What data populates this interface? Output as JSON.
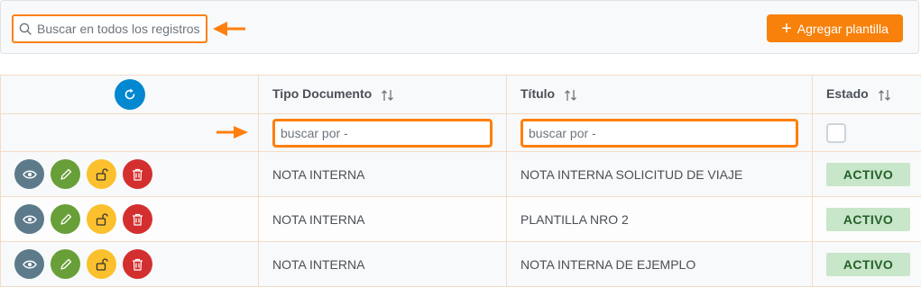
{
  "toolbar": {
    "search_placeholder": "Buscar en todos los registros",
    "add_button_label": "Agregar plantilla"
  },
  "colors": {
    "accent": "#f7810b",
    "highlight": "#ff7f0e",
    "refresh": "#0288d1",
    "view": "#5c7a8a",
    "edit": "#689f38",
    "lock": "#fbc02d",
    "delete": "#d32f2f",
    "status_bg": "#c8e6c9",
    "status_text": "#256029"
  },
  "table": {
    "columns": [
      "",
      "Tipo Documento",
      "Título",
      "Estado"
    ],
    "filter_placeholder": "buscar por -",
    "rows": [
      {
        "tipo": "NOTA INTERNA",
        "titulo": "NOTA INTERNA SOLICITUD DE VIAJE",
        "estado": "ACTIVO"
      },
      {
        "tipo": "NOTA INTERNA",
        "titulo": "PLANTILLA NRO 2",
        "estado": "ACTIVO"
      },
      {
        "tipo": "NOTA INTERNA",
        "titulo": "NOTA INTERNA DE EJEMPLO",
        "estado": "ACTIVO"
      }
    ]
  },
  "icons": [
    "search-icon",
    "arrow-left-icon",
    "plus-icon",
    "refresh-icon",
    "sort-icon",
    "arrow-right-icon",
    "eye-icon",
    "pencil-icon",
    "unlock-icon",
    "trash-icon"
  ]
}
